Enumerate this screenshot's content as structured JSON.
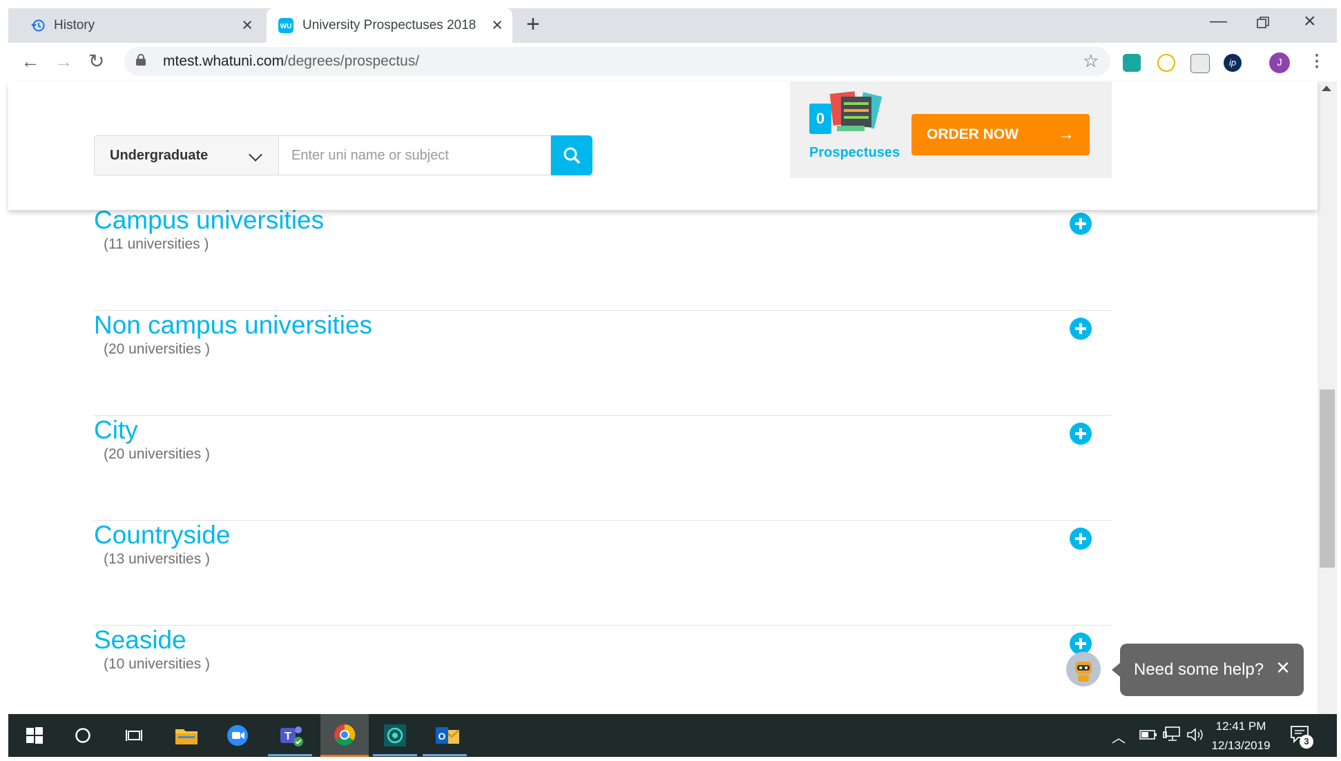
{
  "browser": {
    "tabs": [
      {
        "title": "History",
        "icon": "history-icon",
        "active": false
      },
      {
        "title": "University Prospectuses 2018",
        "icon": "whatuni-favicon",
        "active": true
      }
    ],
    "url_domain": "mtest.whatuni.com",
    "url_path": "/degrees/prospectus/",
    "profile_initial": "J",
    "extensions": [
      "ext-teal-icon",
      "ext-compass-icon",
      "ext-tag-icon",
      "ext-ip-icon"
    ]
  },
  "header": {
    "study_level": "Undergraduate",
    "search_placeholder": "Enter uni name or subject",
    "basket_count": "0",
    "prospectuses_label": "Prospectuses",
    "order_label": "ORDER NOW"
  },
  "categories": [
    {
      "title": "Campus universities",
      "count": "(11 universities )"
    },
    {
      "title": "Non campus universities",
      "count": "(20 universities )"
    },
    {
      "title": "City",
      "count": "(20 universities )"
    },
    {
      "title": "Countryside",
      "count": "(13 universities )"
    },
    {
      "title": "Seaside",
      "count": "(10 universities )"
    }
  ],
  "help": {
    "text": "Need some help?"
  },
  "taskbar": {
    "apps": [
      "windows-start",
      "cortana-search",
      "task-view",
      "file-explorer",
      "zoom",
      "teams",
      "chrome",
      "app-teal",
      "outlook"
    ],
    "time": "12:41 PM",
    "date": "12/13/2019",
    "notifications": "3"
  },
  "colors": {
    "brand": "#00b7ec",
    "order": "#ff8a00",
    "taskbar": "#1f2a2b"
  }
}
